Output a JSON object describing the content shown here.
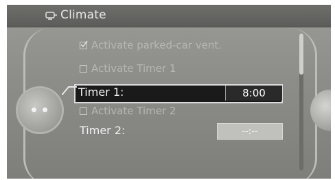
{
  "header": {
    "title": "Climate",
    "icon": "climate-icon"
  },
  "menu": {
    "activate_vent": "Activate parked-car vent.",
    "activate_timer1": "Activate Timer 1",
    "timer1_label": "Timer 1:",
    "timer1_value": "8:00",
    "activate_timer2": "Activate Timer 2",
    "timer2_label": "Timer 2:",
    "timer2_value": "--:--"
  }
}
